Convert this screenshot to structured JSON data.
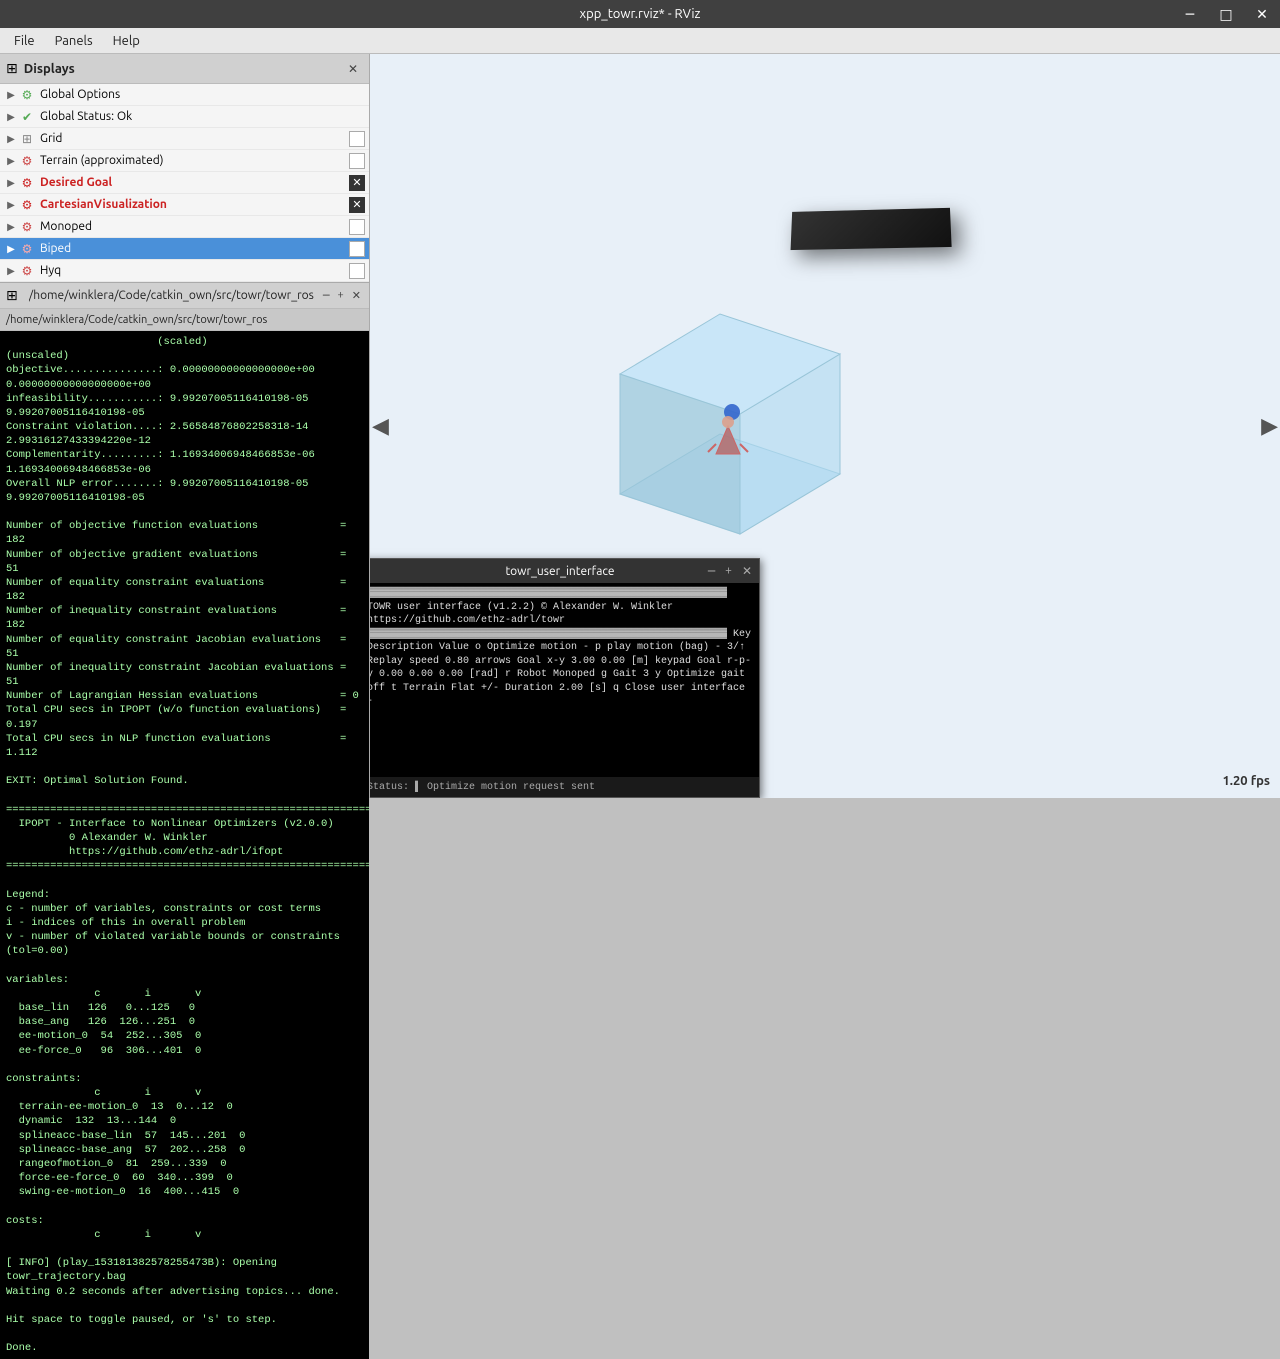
{
  "titlebar": {
    "title": "xpp_towr.rviz* - RViz",
    "min_btn": "─",
    "max_btn": "□",
    "close_btn": "✕"
  },
  "menubar": {
    "items": [
      "File",
      "Panels",
      "Help"
    ]
  },
  "displays_panel": {
    "title": "Displays",
    "items": [
      {
        "name": "Global Options",
        "icon": "gear",
        "icon_color": "#55aa55",
        "has_expand": true,
        "check_type": "none"
      },
      {
        "name": "Global Status: Ok",
        "icon": "check",
        "icon_color": "#55aa55",
        "has_expand": true,
        "check_type": "none"
      },
      {
        "name": "Grid",
        "icon": "grid",
        "icon_color": "#888888",
        "has_expand": true,
        "check_type": "white"
      },
      {
        "name": "Terrain (approximated)",
        "icon": "terrain",
        "icon_color": "#cc4444",
        "has_expand": true,
        "check_type": "white"
      },
      {
        "name": "Desired Goal",
        "icon": "goal",
        "icon_color": "#cc2222",
        "has_expand": true,
        "check_type": "x",
        "selected": false
      },
      {
        "name": "CartesianVisualization",
        "icon": "cartesian",
        "icon_color": "#cc2222",
        "has_expand": true,
        "check_type": "x"
      },
      {
        "name": "Monoped",
        "icon": "mono",
        "icon_color": "#cc4444",
        "has_expand": true,
        "check_type": "white"
      },
      {
        "name": "Biped",
        "icon": "biped",
        "icon_color": "#cc4444",
        "has_expand": true,
        "check_type": "green_filled",
        "selected": true
      },
      {
        "name": "Hyq",
        "icon": "hyq",
        "icon_color": "#cc4444",
        "has_expand": true,
        "check_type": "white"
      }
    ]
  },
  "console_panel": {
    "path": "/home/winklera/Code/catkin_own/src/towr/towr_ros",
    "header_path": "/home/winklera/Code/catkin_own/src...",
    "content": "                        (scaled)               (unscaled)\nobjective...............: 0.00000000000000000e+00   0.00000000000000000e+00\ninfeasibility...........: 9.99207005116410198-05   9.99207005116410198-05\nConstraint violation....: 2.56584876802258318-14   2.99316127433394220e-12\nComplementarity.........: 1.16934006948466853e-06   1.16934006948466853e-06\nOverall NLP error.......: 9.99207005116410198-05   9.99207005116410198-05\n\nNumber of objective function evaluations             = 182\nNumber of objective gradient evaluations             = 51\nNumber of equality constraint evaluations            = 182\nNumber of inequality constraint evaluations          = 182\nNumber of equality constraint Jacobian evaluations   = 51\nNumber of inequality constraint Jacobian evaluations = 51\nNumber of Lagrangian Hessian evaluations             = 0\nTotal CPU secs in IPOPT (w/o function evaluations)   =  0.197\nTotal CPU secs in NLP function evaluations           =  1.112\n\nEXIT: Optimal Solution Found.\n\n================================================================================\n  IPOPT - Interface to Nonlinear Optimizers (v2.0.0)\n          0 Alexander W. Winkler\n          https://github.com/ethz-adrl/ifopt\n================================================================================\n\nLegend:\nc - number of variables, constraints or cost terms\ni - indices of this in overall problem\nv - number of violated variable bounds or constraints (tol=0.00)\n\nvariables:\n              c       i       v\n  base_lin   126   0...125   0\n  base_ang   126  126...251  0\n  ee-motion_0  54  252...305  0\n  ee-force_0   96  306...401  0\n\nconstraints:\n              c       i       v\n  terrain-ee-motion_0  13  0...12  0\n  dynamic  132  13...144  0\n  splineacc-base_lin  57  145...201  0\n  splineacc-base_ang  57  202...258  0\n  rangeofmotion_0  81  259...339  0\n  force-ee-force_0  60  340...399  0\n  swing-ee-motion_0  16  400...415  0\n\ncosts:\n              c       i       v\n\n[ INFO] (play_153181382578255473B): Opening towr_trajectory.bag\nWaiting 0.2 seconds after advertising topics... done.\n\nHit space to toggle paused, or 's' to step.\n\nDone.",
    "controls": [
      "─",
      "+",
      "✕"
    ]
  },
  "viewport": {
    "fps": "1.20 fps",
    "nav_left": "◀",
    "nav_right": "▶"
  },
  "terminal": {
    "title": "towr_user_interface",
    "controls": [
      "─",
      "+",
      "✕"
    ],
    "content": "▓▓▓▓▓▓▓▓▓▓▓▓▓▓▓▓▓▓▓▓▓▓▓▓▓▓▓▓▓▓▓▓▓▓▓▓▓▓▓▓▓▓▓▓▓▓▓▓▓▓▓▓▓▓▓▓▓▓▓▓\n       TOWR user interface (v1.2.2)\n       © Alexander W. Winkler\n       https://github.com/ethz-adrl/towr\n▓▓▓▓▓▓▓▓▓▓▓▓▓▓▓▓▓▓▓▓▓▓▓▓▓▓▓▓▓▓▓▓▓▓▓▓▓▓▓▓▓▓▓▓▓▓▓▓▓▓▓▓▓▓▓▓▓▓▓▓\n\nKey       Description           Value\no         Optimize motion       -\np         play motion (bag)     -\n3/↑       Replay speed          0.80\narrows    Goal x-y              3.00  0.00 [m]\nkeypad    Goal r-p-y            0.00  0.00  0.00 [rad]\nr         Robot                 Monoped\ng         Gait                  3\ny         Optimize gait         off\nt         Terrain               Flat\n+/-       Duration              2.00 [s]\nq         Close user interface  -\n",
    "status": "Status: ▌ Optimize motion request sent"
  }
}
